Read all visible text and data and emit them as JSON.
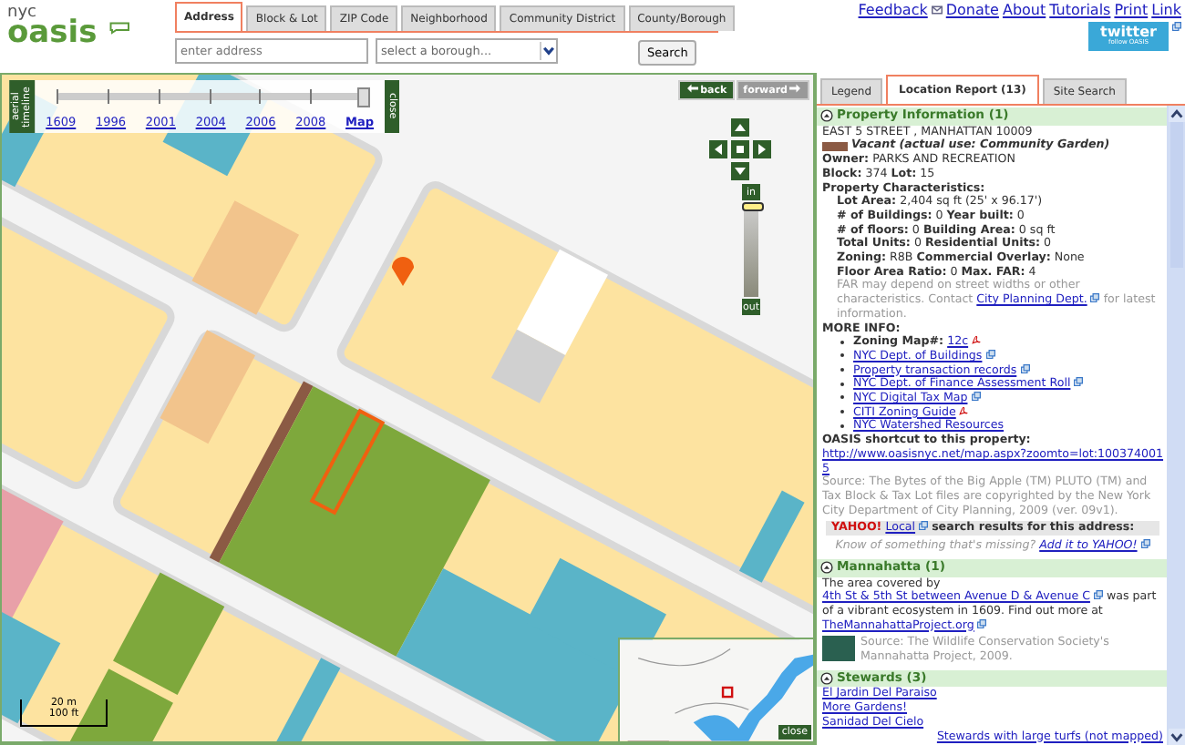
{
  "logo": {
    "small": "nyc",
    "big": "oasis"
  },
  "search_tabs": [
    {
      "label": "Address",
      "selected": true
    },
    {
      "label": "Block & Lot",
      "selected": false
    },
    {
      "label": "ZIP Code",
      "selected": false
    },
    {
      "label": "Neighborhood",
      "selected": false
    },
    {
      "label": "Community District",
      "selected": false
    },
    {
      "label": "County/Borough",
      "selected": false
    }
  ],
  "address_field": {
    "placeholder": "enter address"
  },
  "borough_select": {
    "placeholder": "select a borough..."
  },
  "search_button": "Search",
  "top_links": [
    {
      "label": "Feedback",
      "kind": "mail"
    },
    {
      "label": "Donate",
      "kind": "plain"
    },
    {
      "label": "About",
      "kind": "plain"
    },
    {
      "label": "Tutorials",
      "kind": "plain"
    },
    {
      "label": "Print",
      "kind": "plain"
    },
    {
      "label": "Link",
      "kind": "plain"
    }
  ],
  "twitter_badge": {
    "title": "twitter",
    "subtitle": "follow OASIS"
  },
  "map": {
    "timeline_label": "aerial timeline",
    "years": [
      {
        "label": "1609",
        "selected": false
      },
      {
        "label": "1996",
        "selected": false
      },
      {
        "label": "2001",
        "selected": false
      },
      {
        "label": "2004",
        "selected": false
      },
      {
        "label": "2006",
        "selected": false
      },
      {
        "label": "2008",
        "selected": false
      },
      {
        "label": "Map",
        "selected": true
      }
    ],
    "timeline_slider": {
      "level": 1
    },
    "timeline_close": "close",
    "back": {
      "label": "back",
      "disabled": false
    },
    "forward": {
      "label": "forward",
      "disabled": true
    },
    "zoom_in": "in",
    "zoom_out": "out",
    "zoom_slider": {
      "level": 0.95
    },
    "scale_metric": "20 m",
    "scale_imperial": "100 ft",
    "overview_close": "close"
  },
  "panel": {
    "tabs": [
      {
        "label": "Legend",
        "selected": false
      },
      {
        "label": "Location Report (13)",
        "selected": true
      },
      {
        "label": "Site Search",
        "selected": false
      }
    ],
    "property": {
      "title": "Property Information (1)",
      "expanded": true,
      "address": "EAST 5 STREET , MANHATTAN 10009",
      "land_use": {
        "color": "#8b5a44",
        "label": "Vacant (actual use: Community Garden)"
      },
      "lines": [
        "**Owner:** PARKS AND RECREATION",
        "**Block:** 374 **Lot:** 15"
      ],
      "characteristics_title": "Property Characteristics:",
      "characteristics": [
        "**Lot Area:** 2,404 sq ft (25' x 96.17')",
        "**# of Buildings:** 0 **Year built:** 0",
        "**# of floors:** 0 **Building Area:** 0 sq ft",
        "**Total Units:** 0 **Residential Units:** 0",
        "**Zoning:** R8B **Commercial Overlay:** None",
        "**Floor Area Ratio:** 0 **Max. FAR:** 4"
      ],
      "far_note": "FAR may depend on street widths or other characteristics. Contact",
      "far_link": "City Planning Dept.",
      "far_note_end": "for latest information.",
      "more_info_title": "MORE INFO:",
      "more_info": [
        {
          "prefix": "Zoning Map#:",
          "link": "12c",
          "kind": "pdf"
        },
        {
          "link": "NYC Dept. of Buildings",
          "kind": "external"
        },
        {
          "link": "Property transaction records",
          "kind": "external"
        },
        {
          "link": "NYC Dept. of Finance Assessment Roll",
          "kind": "external"
        },
        {
          "link": "NYC Digital Tax Map",
          "kind": "external"
        },
        {
          "link": "CITI Zoning Guide",
          "kind": "pdf"
        },
        {
          "link": "NYC Watershed Resources",
          "kind": "plain"
        }
      ],
      "shortcut_title": "OASIS shortcut to this property:",
      "shortcut_link": "http://www.oasisnyc.net/map.aspx?zoomto=lot:1003740015",
      "source": "Source: The Bytes of the Big Apple (TM) PLUTO (TM) and Tax Block & Tax Lot files are copyrighted by the New York City Department of City Planning, 2009 (ver. 09v1).",
      "yahoo_logo": "YAHOO!",
      "yahoo_link": "Local",
      "yahoo_text": "search results for this address:",
      "missing_text": "Know of something that's missing?",
      "missing_link": "Add it to YAHOO!"
    },
    "mannahatta": {
      "title": "Mannahatta (1)",
      "expanded": true,
      "text_start": "The area covered by",
      "area_link": "4th St & 5th St between Avenue D & Avenue C",
      "text_mid": "was part of a vibrant ecosystem in 1609. Find out more at",
      "site_link": "TheMannahattaProject.org",
      "source": "Source: The Wildlife Conservation Society's Mannahatta Project, 2009."
    },
    "stewards": {
      "title": "Stewards (3)",
      "expanded": true,
      "links": [
        "El Jardin Del Paraiso",
        "More Gardens!",
        "Sanidad Del Cielo"
      ],
      "large_turfs_link": "Stewards with large turfs (not mapped)"
    }
  }
}
